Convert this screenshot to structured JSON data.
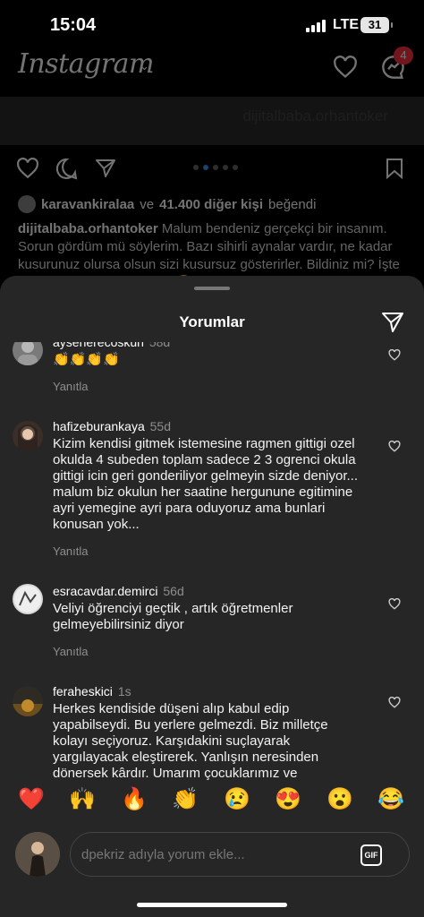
{
  "status_bar": {
    "time": "15:04",
    "network": "LTE",
    "battery": "31"
  },
  "app": {
    "logo": "Instagram",
    "messages_badge": "4"
  },
  "post": {
    "watermark": "dijitalbaba.orhantoker",
    "carousel_active_index": 1,
    "likes": {
      "user": "karavankiralaa",
      "connector": "ve",
      "count": "41.400 diğer kişi",
      "suffix": "beğendi"
    },
    "caption": {
      "user": "dijitalbaba.orhantoker",
      "text": "Malum bendeniz gerçekçi bir insanım. Sorun gördüm mü söylerim. Bazı sihirli aynalar vardır, ne kadar kusurunuz olursa olsun sizi kusursuz gösterirler. Bildiniz mi? İşte ben o aynalardan değilim. 😌"
    }
  },
  "comments_sheet": {
    "title": "Yorumlar",
    "comments": [
      {
        "username": "aysenerecoskun",
        "age": "58d",
        "text": "👏👏👏👏",
        "reply_label": "Yanıtla"
      },
      {
        "username": "hafizeburankaya",
        "age": "55d",
        "text": "Kizim kendisi gitmek istemesine ragmen  gittigi ozel okulda 4 subeden toplam sadece  2  3 ogrenci okula gittigi icin geri gonderiliyor gelmeyin sizde deniyor... malum biz okulun her saatine hergunune egitimine ayri yemegine ayri para oduyoruz  ama bunlari konusan yok...",
        "reply_label": "Yanıtla"
      },
      {
        "username": "esracavdar.demirci",
        "age": "56d",
        "text": "Veliyi öğrenciyi geçtik , artık öğretmenler gelmeyebilirsiniz diyor",
        "reply_label": "Yanıtla"
      },
      {
        "username": "feraheskici",
        "age": "1s",
        "text": "Herkes kendiside düşeni alıp kabul edip yapabilseydi. Bu yerlere gelmezdi. Biz milletçe kolayı seçiyoruz. Karşıdakini suçlayarak yargılayacak eleştirerek. Yanlışın neresinden dönersek kârdır. Umarım çocuklarımız ve",
        "reply_label": "Yanıtla"
      }
    ],
    "quick_emojis": [
      "❤️",
      "🙌",
      "🔥",
      "👏",
      "😢",
      "😍",
      "😮",
      "😂"
    ],
    "input": {
      "placeholder": "dpekriz adıyla yorum ekle...",
      "gif_label": "GIF"
    }
  }
}
